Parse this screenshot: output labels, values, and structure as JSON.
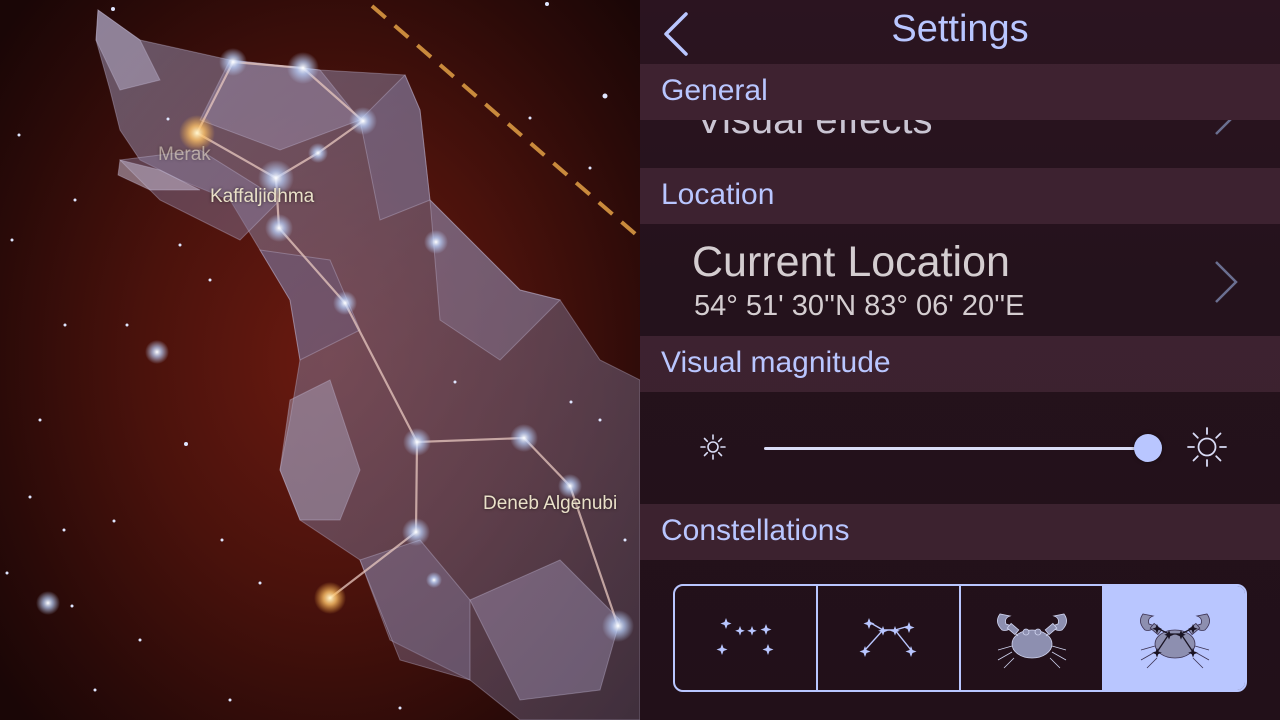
{
  "sky": {
    "labels": {
      "star1": "Merak",
      "star2": "Kaffaljidhma",
      "star3": "Deneb Algenubi"
    }
  },
  "settings": {
    "title": "Settings",
    "back_icon": "chevron-left-icon",
    "sections": {
      "general": {
        "header": "General",
        "row_label": "Visual effects"
      },
      "location": {
        "header": "Location",
        "title": "Current Location",
        "coords": "54° 51' 30''N 83° 06' 20''E"
      },
      "visual_magnitude": {
        "header": "Visual magnitude",
        "level": 0.99,
        "min_icon": "sun-small-icon",
        "max_icon": "sun-large-icon"
      },
      "constellations": {
        "header": "Constellations",
        "options": [
          {
            "id": "stars-only",
            "icon": "stars-icon"
          },
          {
            "id": "lines",
            "icon": "constellation-lines-icon"
          },
          {
            "id": "figure",
            "icon": "crab-figure-icon"
          },
          {
            "id": "figure-lines",
            "icon": "crab-figure-lines-icon"
          }
        ],
        "selected_index": 3
      }
    },
    "colors": {
      "accent": "#b9c6ff",
      "panel_bg": "#24121c",
      "section_bg": "#462837"
    }
  }
}
